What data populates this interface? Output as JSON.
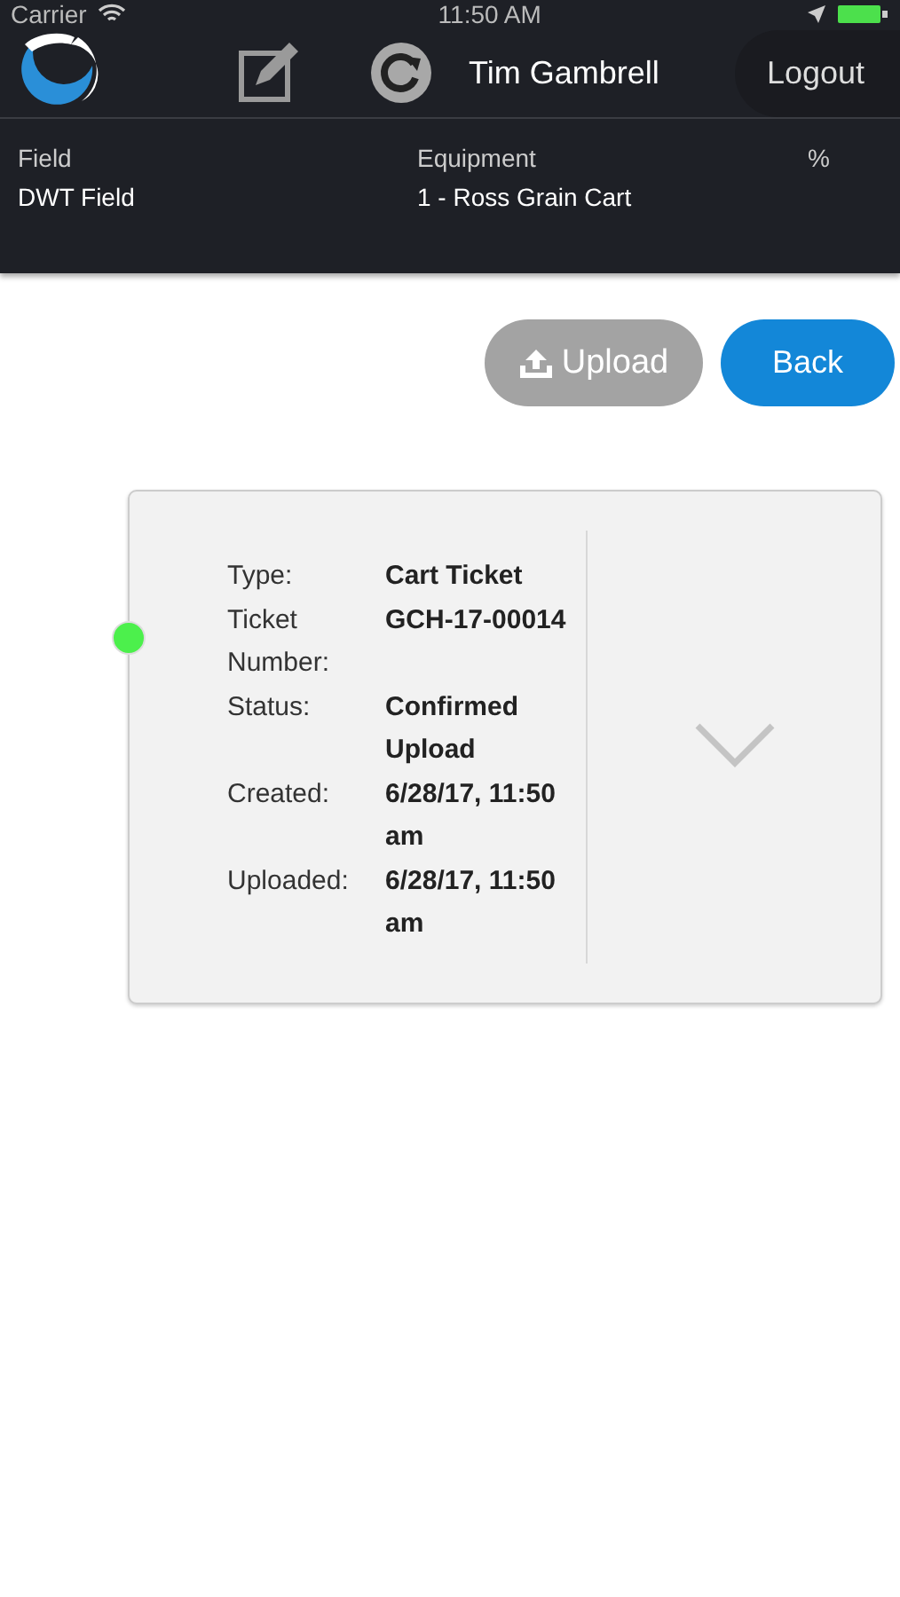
{
  "status_bar": {
    "carrier": "Carrier",
    "time": "11:50 AM"
  },
  "header": {
    "user": "Tim Gambrell",
    "logout": "Logout"
  },
  "info": {
    "columns": [
      "Field",
      "Equipment",
      "%"
    ],
    "values": [
      "DWT Field",
      "1 - Ross Grain Cart"
    ]
  },
  "buttons": [
    {
      "label": "Upload",
      "kind": "upload",
      "disabled": true
    },
    {
      "label": "Back",
      "kind": "back",
      "disabled": false
    }
  ],
  "ticket": {
    "status_dot": {
      "color": "#4cf04c"
    },
    "fields": [
      {
        "label": "Type:",
        "value": "Cart Ticket"
      },
      {
        "label": "Ticket Number:",
        "value": "GCH-17-00014"
      },
      {
        "label": "Status:",
        "value": "Confirmed Upload"
      },
      {
        "label": "Created:",
        "value": "6/28/17, 11:50 am"
      },
      {
        "label": "Uploaded:",
        "value": "6/28/17, 11:50 am"
      }
    ]
  }
}
